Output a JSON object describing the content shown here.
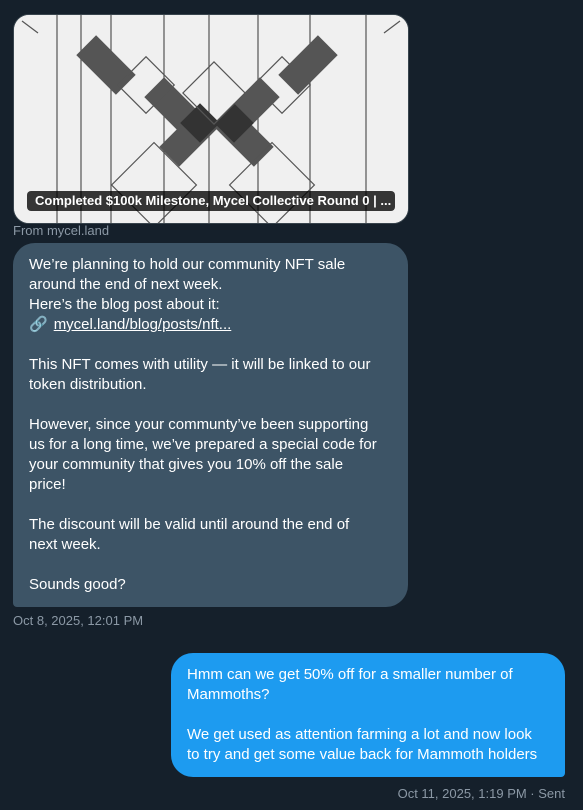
{
  "link_card": {
    "title": "Completed $100k Milestone, Mycel Collective Round 0 | ...",
    "source": "From mycel.land"
  },
  "incoming_message": {
    "line1": "We’re planning to hold our community NFT sale",
    "line2": "around the end of next week.",
    "line3": "Here’s the blog post about it:",
    "link_icon": "🔗",
    "link_text": "mycel.land/blog/posts/nft...",
    "para2_line1": "This NFT comes with utility — it will be linked to our",
    "para2_line2": "token distribution.",
    "para3_line1": "However, since your communty’ve been supporting",
    "para3_line2": "us for a long time, we’ve prepared a special code for",
    "para3_line3": "your community that gives you 10% off the sale",
    "para3_line4": "price!",
    "para4_line1": "The discount will be valid until around the end of",
    "para4_line2": "next week.",
    "para5": "Sounds good?",
    "timestamp": "Oct 8, 2025, 12:01 PM"
  },
  "outgoing_message": {
    "para1_line1": "Hmm can we get 50% off for a smaller number of",
    "para1_line2": "Mammoths?",
    "para2_line1": "We get used as attention farming a lot and now look",
    "para2_line2": "to try and get some value back for Mammoth holders",
    "timestamp": "Oct 11, 2025, 1:19 PM · Sent"
  },
  "colors": {
    "background": "#15202b",
    "incoming_bubble": "#3d5466",
    "outgoing_bubble": "#1d9bf0",
    "meta_text": "#8b98a5"
  }
}
